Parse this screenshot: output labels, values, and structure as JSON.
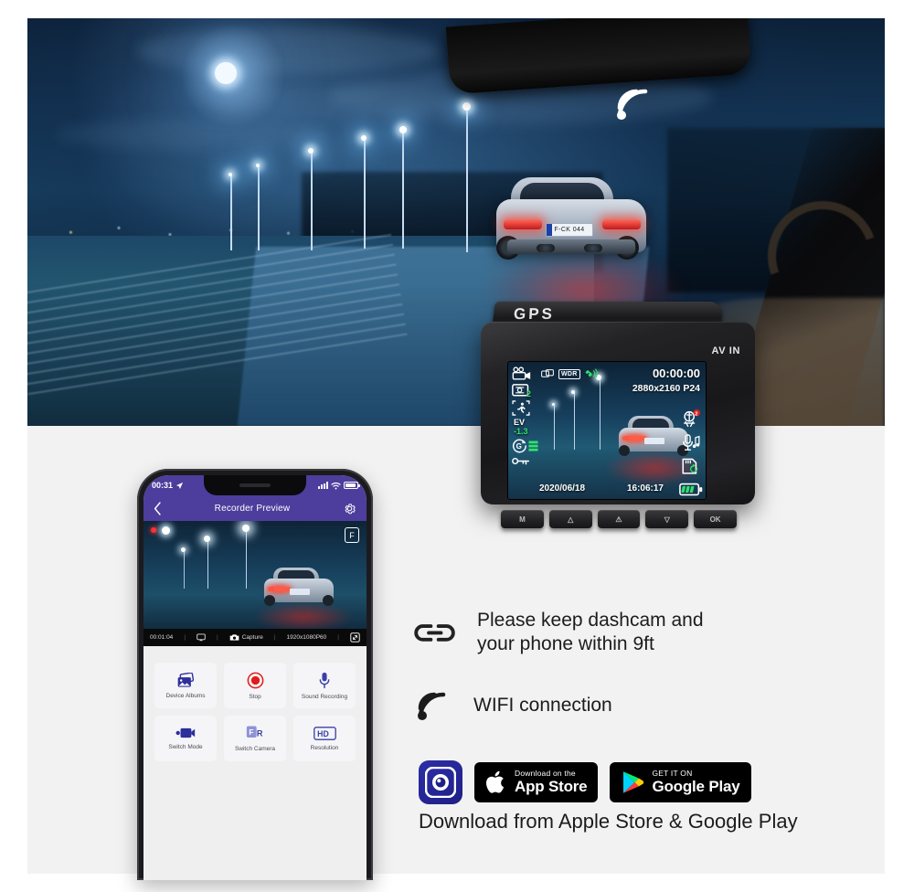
{
  "hero": {
    "wifi_icon": "wifi-signal-icon",
    "scene": "night highway with car seen through windshield",
    "car_plate": "F-CK 044"
  },
  "dashcam": {
    "brand_label": "GPS",
    "av_in_label": "AV IN",
    "screen": {
      "timer": "00:00:00",
      "resolution": "2880x2160 P24",
      "date": "2020/06/18",
      "time": "16:06:17",
      "ev_label": "EV",
      "ev_value": "-1.3",
      "loop_value": "2",
      "wdr_label": "WDR",
      "icons_left": [
        "video-camera-icon",
        "loop-recording-icon",
        "motion-detection-icon",
        "exposure-value-icon",
        "g-sensor-icon",
        "key-lock-icon"
      ],
      "icons_top": [
        "screen-mirror-icon",
        "wdr-icon",
        "gps-satellite-icon"
      ],
      "icons_right": [
        "parking-monitor-icon",
        "microphone-audio-icon",
        "sd-card-loop-icon",
        "battery-icon"
      ]
    },
    "buttons": [
      {
        "name": "menu-button",
        "label": "M"
      },
      {
        "name": "up-button",
        "label": "△"
      },
      {
        "name": "emergency-button",
        "label": "⚠"
      },
      {
        "name": "down-button",
        "label": "▽"
      },
      {
        "name": "ok-button",
        "label": "OK"
      }
    ]
  },
  "phone": {
    "status": {
      "time": "00:31",
      "location_icon": "location-arrow-icon",
      "signal_icon": "cellular-bars-icon",
      "wifi_icon": "wifi-icon",
      "battery_icon": "battery-icon"
    },
    "appbar": {
      "back_icon": "chevron-left-icon",
      "title": "Recorder Preview",
      "settings_icon": "gear-icon"
    },
    "preview": {
      "rec_indicator": "recording-dot",
      "front_badge": "F"
    },
    "video_toolbar": {
      "elapsed": "00:01:04",
      "screen_icon": "screen-icon",
      "capture_label": "Capture",
      "capture_icon": "camera-icon",
      "resolution": "1920x1080P60",
      "fullscreen_icon": "fullscreen-icon",
      "separator": "|"
    },
    "tiles": [
      {
        "name": "device-albums",
        "label": "Device Albums",
        "icon": "photos-stack-icon"
      },
      {
        "name": "stop",
        "label": "Stop",
        "icon": "record-stop-icon"
      },
      {
        "name": "sound-recording",
        "label": "Sound Recording",
        "icon": "microphone-icon"
      },
      {
        "name": "switch-mode",
        "label": "Switch Mode",
        "icon": "camcorder-icon"
      },
      {
        "name": "switch-camera",
        "label": "Switch Camera",
        "icon": "front-rear-icon"
      },
      {
        "name": "resolution",
        "label": "Resolution",
        "icon": "hd-icon"
      }
    ]
  },
  "features": [
    {
      "icon": "chain-link-icon",
      "line1": "Please keep dashcam and",
      "line2": "your phone within 9ft"
    },
    {
      "icon": "wifi-signal-icon",
      "line1": "WIFI connection",
      "line2": ""
    }
  ],
  "download": {
    "app_logo_icon": "app-logo-icon",
    "apple": {
      "small": "Download on the",
      "large": "App Store",
      "icon": "apple-logo-icon"
    },
    "google": {
      "small": "GET IT ON",
      "large": "Google Play",
      "icon": "google-play-icon"
    },
    "caption": "Download from Apple Store & Google Play"
  },
  "colors": {
    "accent_purple": "#4d3d9c",
    "page_bg": "#f2f2f2",
    "osd_green": "#2fe36a",
    "record_red": "#e02020"
  }
}
